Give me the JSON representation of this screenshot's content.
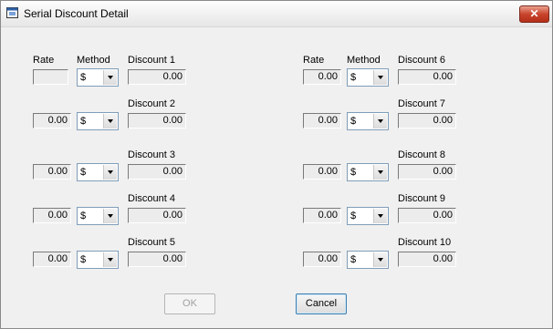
{
  "window": {
    "title": "Serial Discount Detail"
  },
  "headers": {
    "rate": "Rate",
    "method": "Method"
  },
  "left_rows": [
    {
      "discount_label": "Discount 1",
      "rate": "",
      "method": "$",
      "discount": "0.00"
    },
    {
      "discount_label": "Discount 2",
      "rate": "0.00",
      "method": "$",
      "discount": "0.00"
    },
    {
      "discount_label": "Discount 3",
      "rate": "0.00",
      "method": "$",
      "discount": "0.00"
    },
    {
      "discount_label": "Discount 4",
      "rate": "0.00",
      "method": "$",
      "discount": "0.00"
    },
    {
      "discount_label": "Discount 5",
      "rate": "0.00",
      "method": "$",
      "discount": "0.00"
    }
  ],
  "right_rows": [
    {
      "discount_label": "Discount 6",
      "rate": "0.00",
      "method": "$",
      "discount": "0.00"
    },
    {
      "discount_label": "Discount 7",
      "rate": "0.00",
      "method": "$",
      "discount": "0.00"
    },
    {
      "discount_label": "Discount 8",
      "rate": "0.00",
      "method": "$",
      "discount": "0.00"
    },
    {
      "discount_label": "Discount 9",
      "rate": "0.00",
      "method": "$",
      "discount": "0.00"
    },
    {
      "discount_label": "Discount 10",
      "rate": "0.00",
      "method": "$",
      "discount": "0.00"
    }
  ],
  "buttons": {
    "ok": "OK",
    "cancel": "Cancel",
    "close": "✕"
  },
  "icons": {
    "app": "window-app-icon",
    "close": "close-icon",
    "dropdown": "chevron-down-icon"
  }
}
